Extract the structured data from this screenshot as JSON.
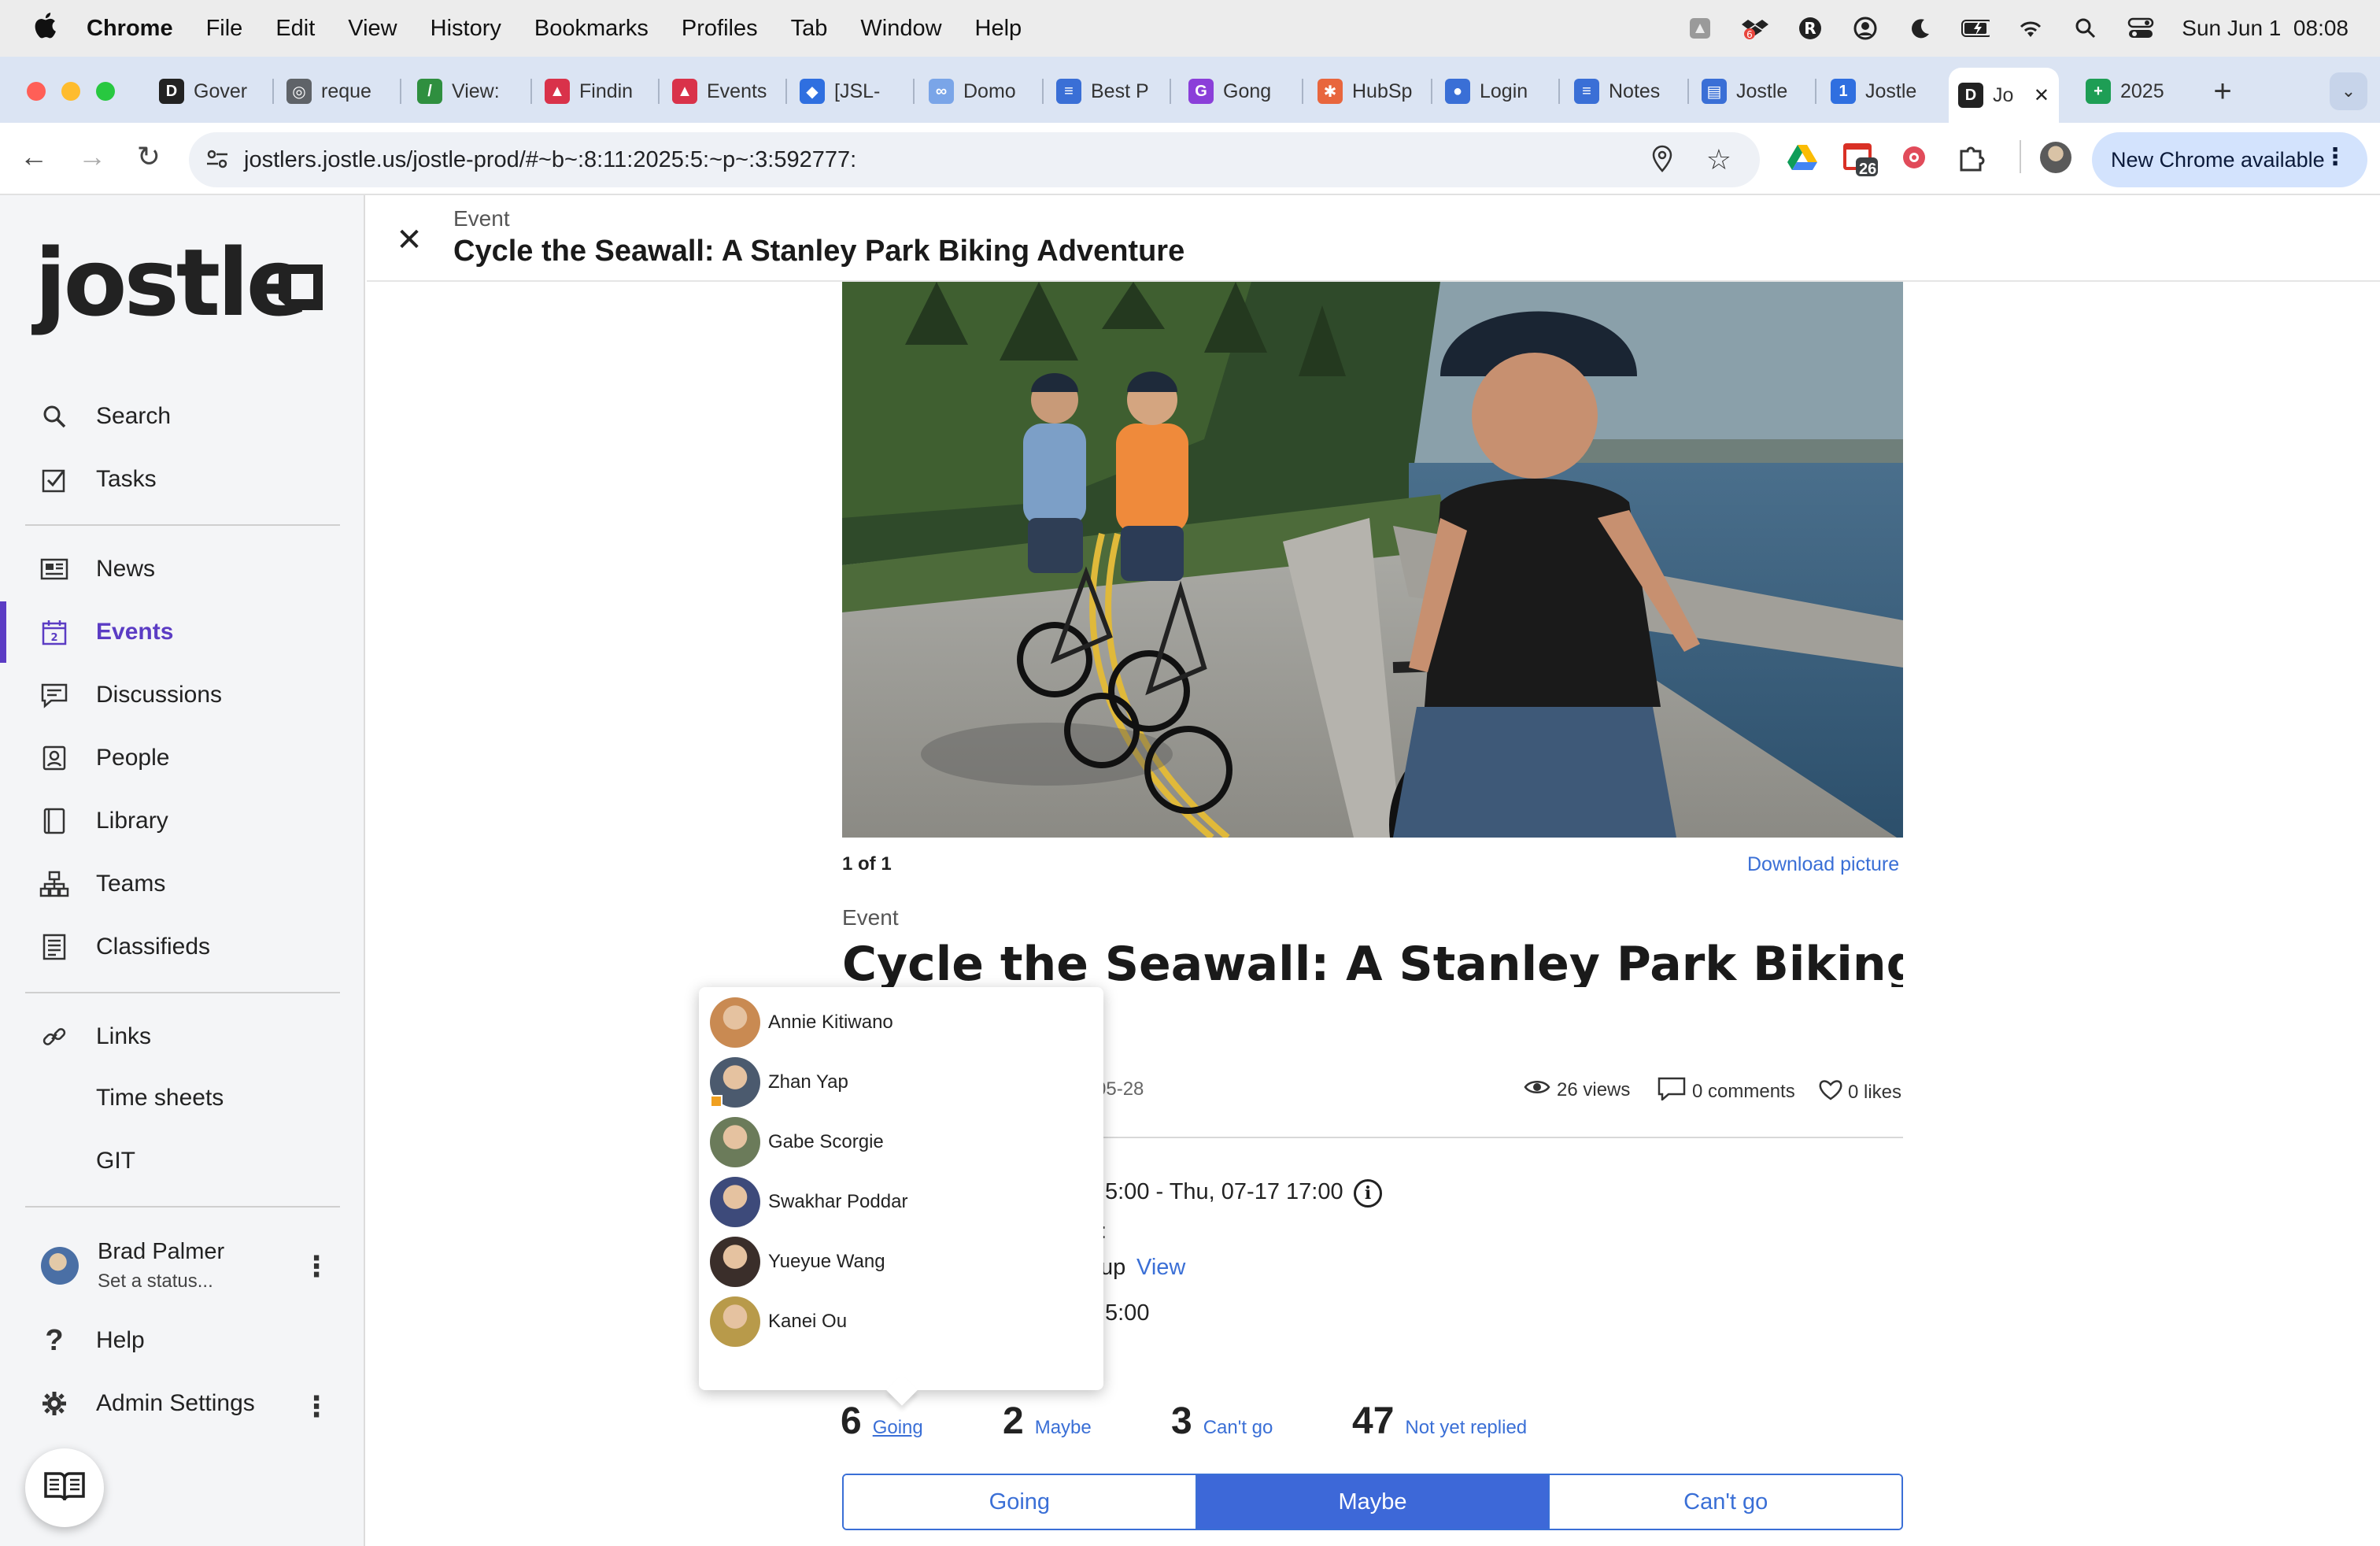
{
  "menubar": {
    "app": "Chrome",
    "items": [
      "File",
      "Edit",
      "View",
      "History",
      "Bookmarks",
      "Profiles",
      "Tab",
      "Window",
      "Help"
    ],
    "clock": "Sun Jun 1  08:08"
  },
  "tabs": [
    {
      "title": "Gover",
      "color": "#222222",
      "glyph": "D"
    },
    {
      "title": "reque",
      "color": "#5f6368",
      "glyph": "◎"
    },
    {
      "title": "View:",
      "color": "#2f8f3f",
      "glyph": "/"
    },
    {
      "title": "Findin",
      "color": "#d9324a",
      "glyph": "▲"
    },
    {
      "title": "Events",
      "color": "#d9324a",
      "glyph": "▲"
    },
    {
      "title": "[JSL-",
      "color": "#2f6fe0",
      "glyph": "◆"
    },
    {
      "title": "Domo",
      "color": "#7aa5e8",
      "glyph": "∞"
    },
    {
      "title": "Best P",
      "color": "#3a6fd6",
      "glyph": "≡"
    },
    {
      "title": "Gong",
      "color": "#8b3fd9",
      "glyph": "G"
    },
    {
      "title": "HubSp",
      "color": "#e8663d",
      "glyph": "✱"
    },
    {
      "title": "Login",
      "color": "#3a6fd6",
      "glyph": "●"
    },
    {
      "title": "Notes",
      "color": "#3a6fd6",
      "glyph": "≡"
    },
    {
      "title": "Jostle",
      "color": "#3a6fd6",
      "glyph": "▤"
    },
    {
      "title": "Jostle",
      "color": "#2f6fe0",
      "glyph": "1"
    },
    {
      "title": "Jo",
      "color": "#222222",
      "glyph": "D"
    },
    {
      "title": "2025",
      "color": "#1e9e55",
      "glyph": "+"
    }
  ],
  "address": {
    "url": "jostlers.jostle.us/jostle-prod/#~b~:8:11:2025:5:~p~:3:592777:",
    "calendar_badge": "26",
    "update_label": "New Chrome available"
  },
  "sidebar": {
    "logo": "jostle",
    "items": [
      {
        "label": "Search",
        "icon": "search-icon"
      },
      {
        "label": "Tasks",
        "icon": "tasks-icon"
      },
      {
        "label": "News",
        "icon": "news-icon"
      },
      {
        "label": "Events",
        "icon": "calendar-icon",
        "active": true
      },
      {
        "label": "Discussions",
        "icon": "discussions-icon"
      },
      {
        "label": "People",
        "icon": "people-icon"
      },
      {
        "label": "Library",
        "icon": "library-icon"
      },
      {
        "label": "Teams",
        "icon": "teams-icon"
      },
      {
        "label": "Classifieds",
        "icon": "classifieds-icon"
      },
      {
        "label": "Links",
        "icon": "link-icon"
      },
      {
        "label": "Time sheets",
        "icon": ""
      },
      {
        "label": "GIT",
        "icon": ""
      }
    ],
    "user": {
      "name": "Brad Palmer",
      "status": "Set a status..."
    },
    "help": "Help",
    "admin": "Admin Settings"
  },
  "header": {
    "kind": "Event",
    "title": "Cycle the Seawall: A Stanley Park Biking Adventure"
  },
  "gallery": {
    "counter": "1 of 1",
    "download": "Download picture"
  },
  "event": {
    "kind": "Event",
    "title": "Cycle the Seawall: A Stanley Park Biking",
    "date_fragment": "05-28",
    "views": "26 views",
    "comments": "0 comments",
    "likes": "0 likes",
    "time_fragment": "5:00 - Thu, 07-17 17:00",
    "colon_fragment": ":",
    "group_fragment": "up",
    "view_link": "View",
    "time2_fragment": "5:00"
  },
  "rsvp": {
    "going_count": "6",
    "going_label": "Going",
    "maybe_count": "2",
    "maybe_label": "Maybe",
    "cant_count": "3",
    "cant_label": "Can't go",
    "not_count": "47",
    "not_label": "Not yet replied",
    "buttons": {
      "going": "Going",
      "maybe": "Maybe",
      "cant": "Can't go"
    }
  },
  "attendees": [
    {
      "name": "Annie Kitiwano",
      "color": "#c98a52"
    },
    {
      "name": "Zhan Yap",
      "color": "#4b5a6e"
    },
    {
      "name": "Gabe Scorgie",
      "color": "#6b7b5a"
    },
    {
      "name": "Swakhar Poddar",
      "color": "#3d4a7a"
    },
    {
      "name": "Yueyue Wang",
      "color": "#3a2e2a"
    },
    {
      "name": "Kanei Ou",
      "color": "#b89a4a"
    }
  ]
}
